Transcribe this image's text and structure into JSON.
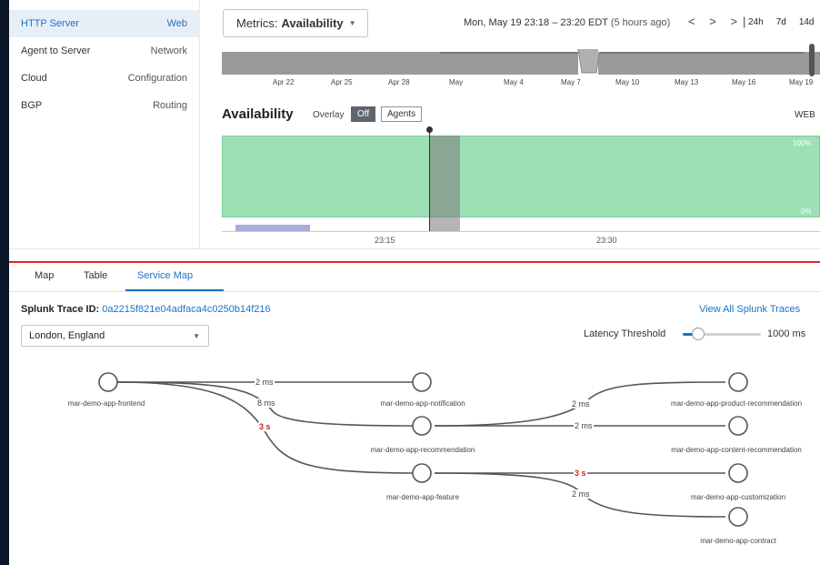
{
  "sidebar": {
    "items": [
      {
        "label": "HTTP Server",
        "category": "Web",
        "active": true
      },
      {
        "label": "Agent to Server",
        "category": "Network"
      },
      {
        "label": "Cloud",
        "category": "Configuration"
      },
      {
        "label": "BGP",
        "category": "Routing"
      }
    ]
  },
  "header": {
    "metrics_prefix": "Metrics:",
    "metrics_value": "Availability",
    "date_range": "Mon, May 19 23:18 – 23:20 EDT",
    "date_ago": "(5 hours ago)",
    "nav_prev": "<",
    "nav_next": ">",
    "nav_last": ">|",
    "ranges": [
      "24h",
      "7d",
      "14d"
    ]
  },
  "overview": {
    "ticks": [
      "Apr 22",
      "Apr 25",
      "Apr 28",
      "May",
      "May 4",
      "May 7",
      "May 10",
      "May 13",
      "May 16",
      "May 19"
    ]
  },
  "availability": {
    "title": "Availability",
    "overlay_label": "Overlay",
    "toggle_off": "Off",
    "toggle_agents": "Agents",
    "target_label": "WEB",
    "y_max_label": "100%",
    "y_min_label": "0%",
    "time_ticks": [
      "23:15",
      "23:30"
    ]
  },
  "tabs": [
    {
      "label": "Map"
    },
    {
      "label": "Table"
    },
    {
      "label": "Service Map",
      "active": true
    }
  ],
  "trace": {
    "label": "Splunk Trace ID:",
    "id": "0a2215f821e04adfaca4c0250b14f216",
    "view_all": "View All Splunk Traces"
  },
  "location": {
    "selected": "London, England"
  },
  "latency": {
    "label": "Latency Threshold",
    "value": "1000 ms"
  },
  "service_map": {
    "nodes": [
      {
        "id": "frontend",
        "label": "mar-demo-app-frontend"
      },
      {
        "id": "notification",
        "label": "mar-demo-app-notification"
      },
      {
        "id": "recommendation",
        "label": "mar-demo-app-recommendation"
      },
      {
        "id": "feature",
        "label": "mar-demo-app-feature"
      },
      {
        "id": "product",
        "label": "mar-demo-app-product-recommendation"
      },
      {
        "id": "content",
        "label": "mar-demo-app-content-recommendation"
      },
      {
        "id": "customization",
        "label": "mar-demo-app-customization"
      },
      {
        "id": "contract",
        "label": "mar-demo-app-contract"
      }
    ],
    "edges": [
      {
        "from": "frontend",
        "to": "notification",
        "latency": "2 ms"
      },
      {
        "from": "frontend",
        "to": "recommendation",
        "latency": "8 ms"
      },
      {
        "from": "frontend",
        "to": "feature",
        "latency": "3 s",
        "slow": true
      },
      {
        "from": "recommendation",
        "to": "product",
        "latency": "2 ms"
      },
      {
        "from": "recommendation",
        "to": "content",
        "latency": "2 ms"
      },
      {
        "from": "feature",
        "to": "customization",
        "latency": "3 s",
        "slow": true
      },
      {
        "from": "feature",
        "to": "contract",
        "latency": "2 ms"
      }
    ]
  }
}
